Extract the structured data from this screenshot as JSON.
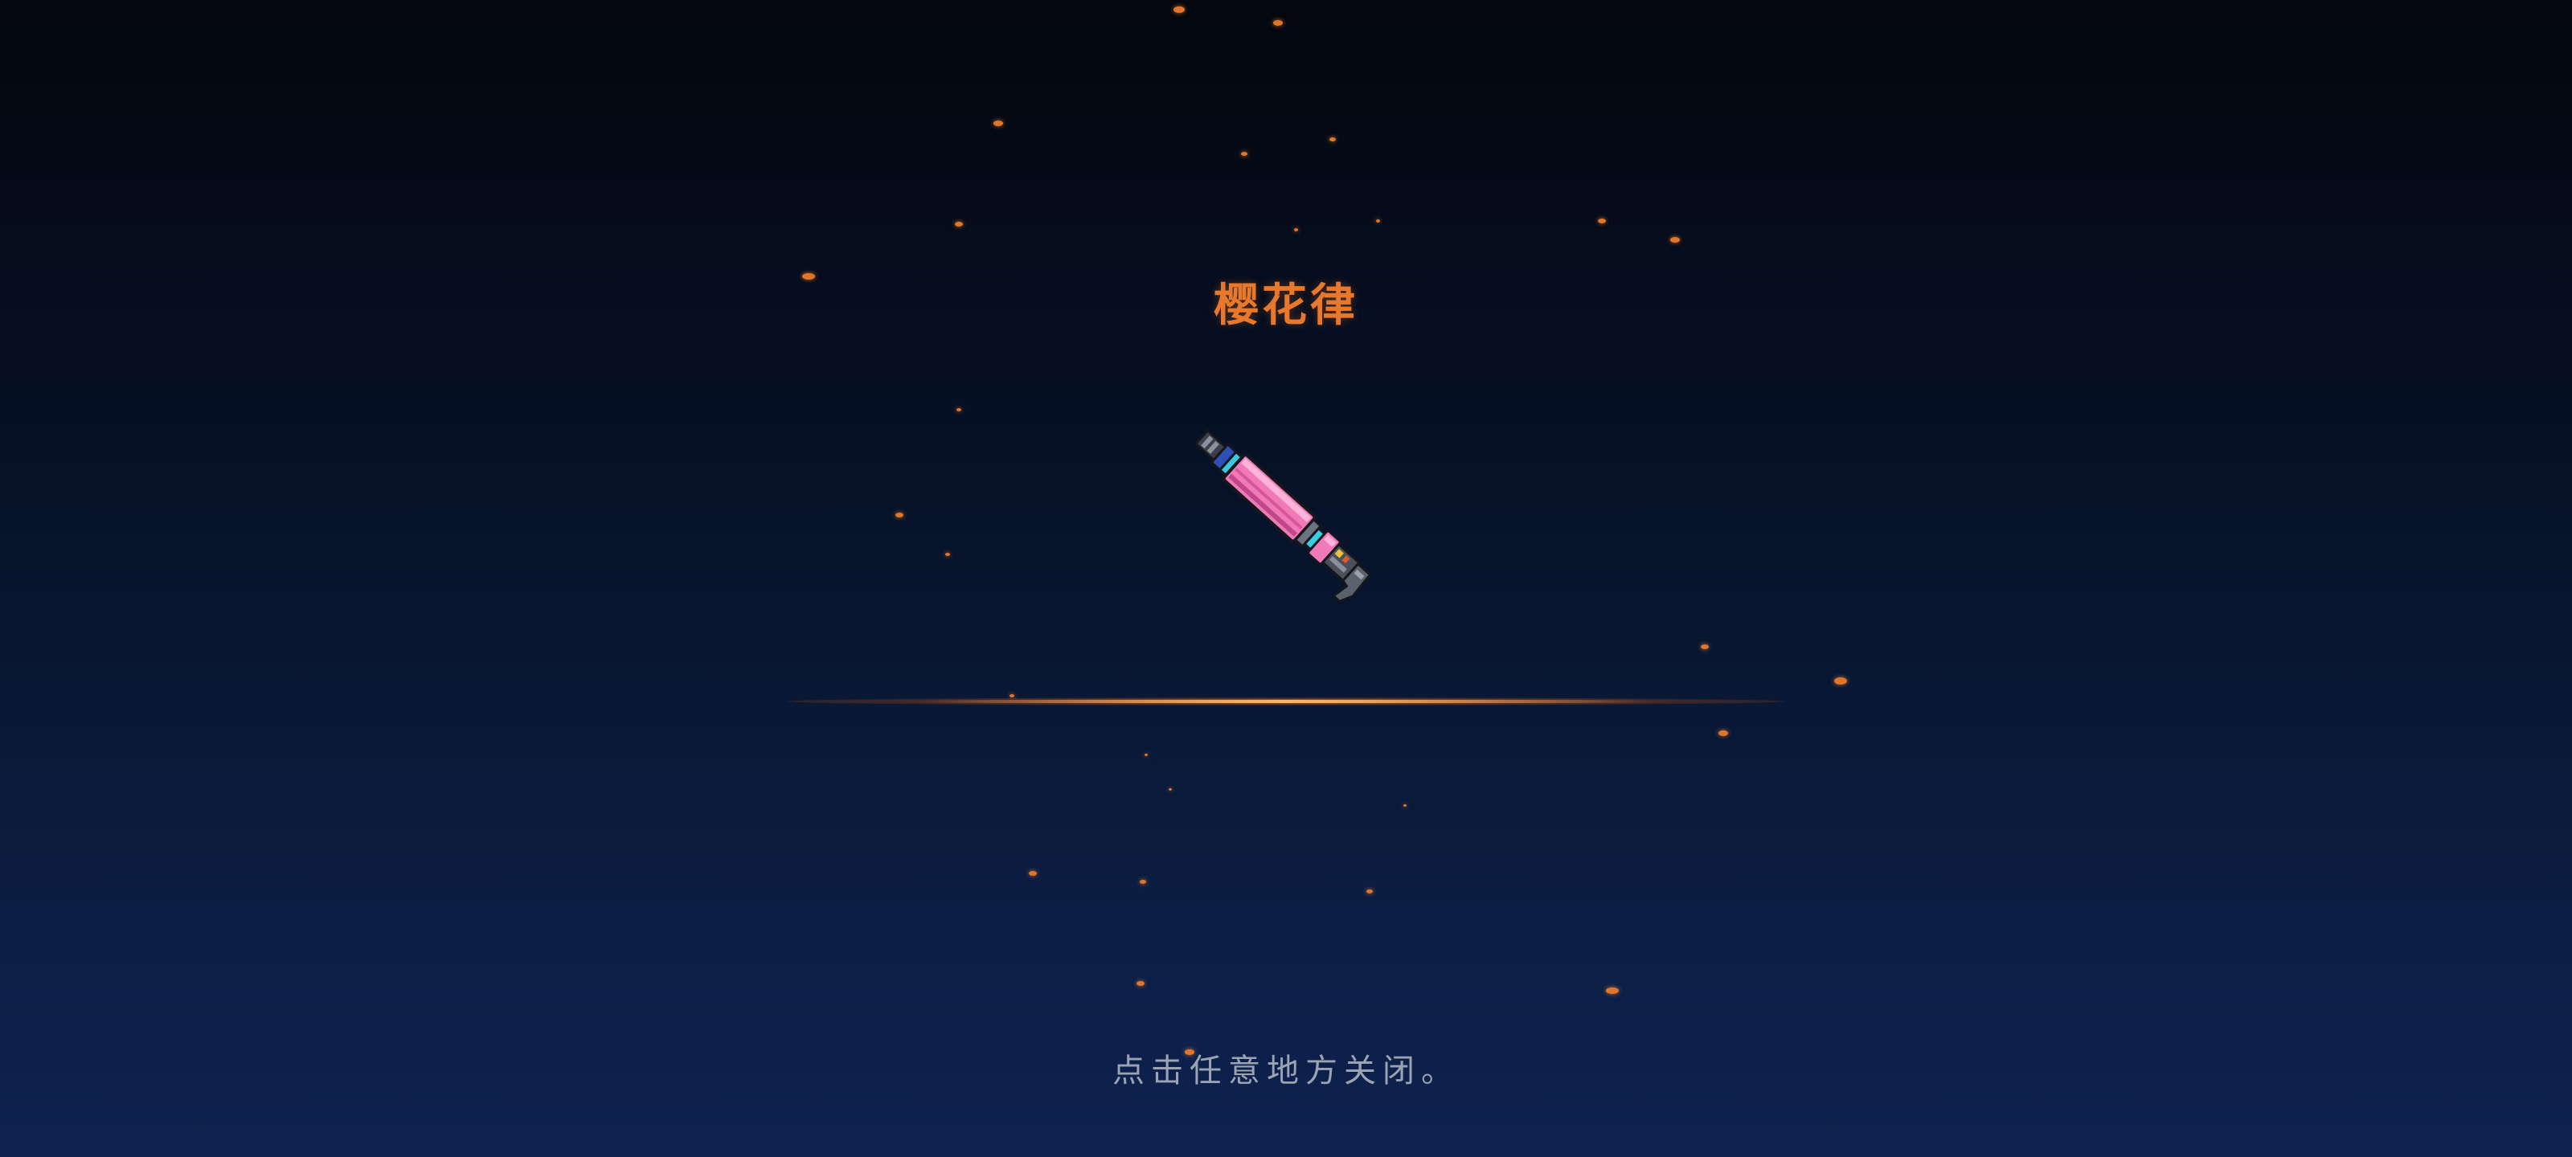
{
  "reward": {
    "item_name": "樱花律",
    "item_name_color": "#e8782c",
    "close_hint": "点击任意地方关闭。",
    "weapon_icon": "pink-laser-rifle-icon",
    "weapon_colors": {
      "barrel": "#f07ab8",
      "barrel_highlight": "#ffb3da",
      "metal": "#5a6270",
      "outline": "#1a1d24"
    }
  }
}
